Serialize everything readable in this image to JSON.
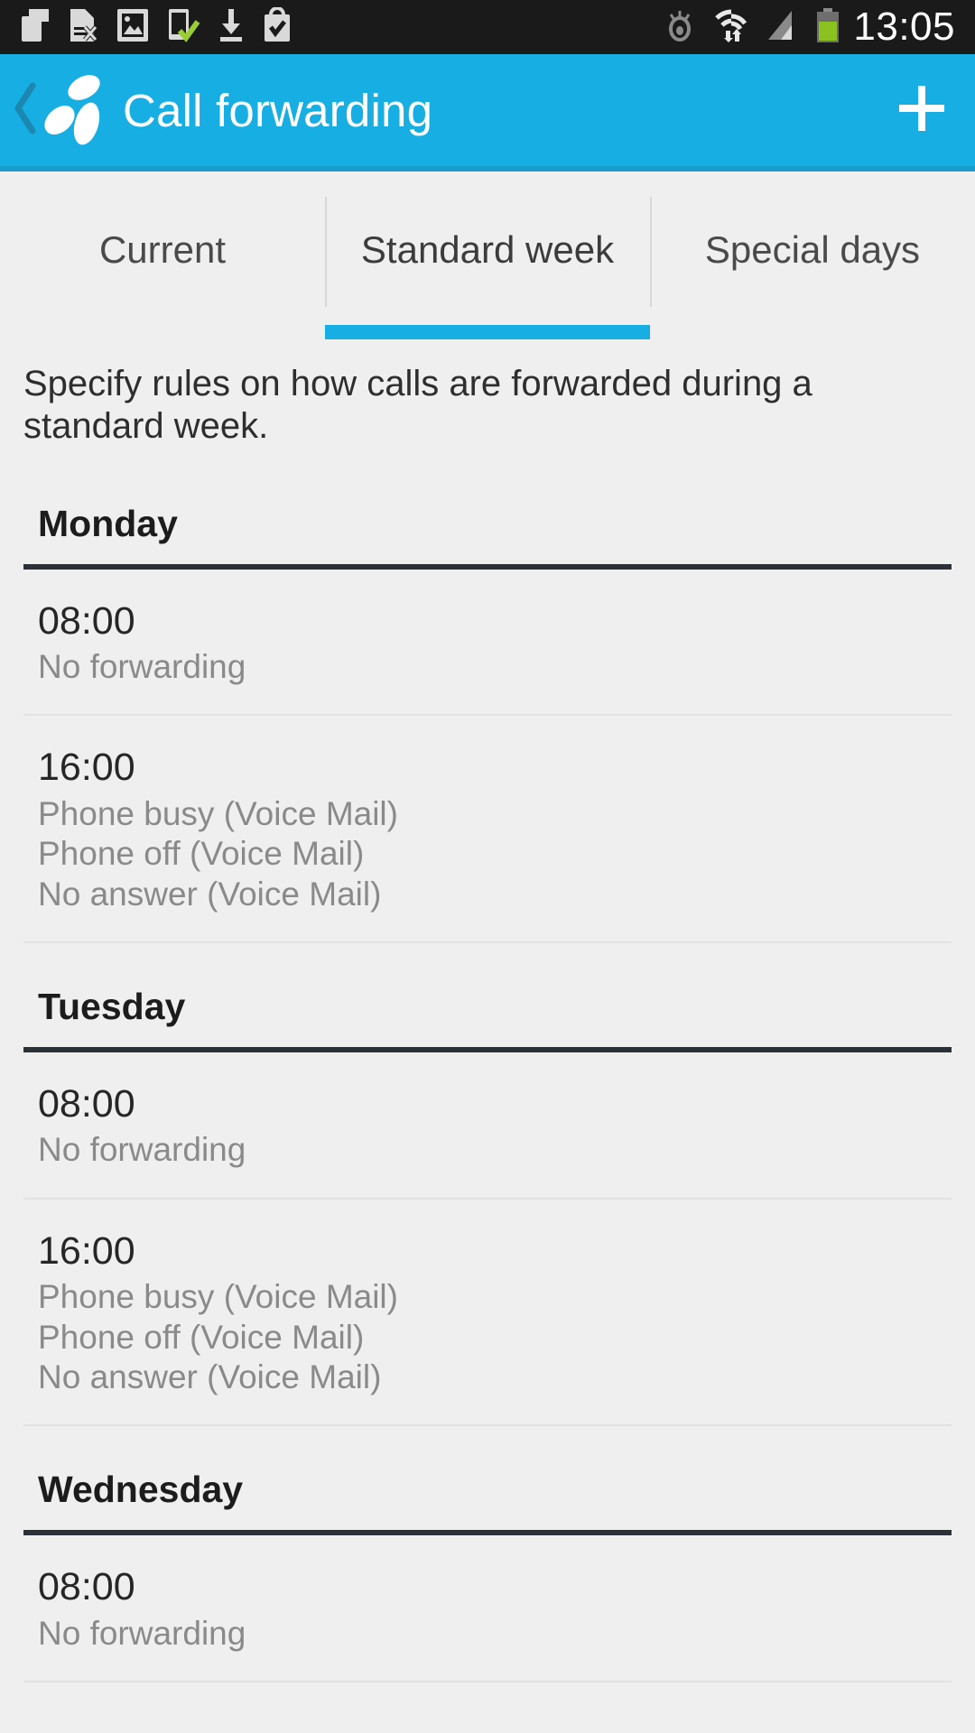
{
  "status_bar": {
    "time": "13:05",
    "left_icons": [
      "sim-card-icon",
      "sim-card-error-icon",
      "screenshot-image-icon",
      "device-check-icon",
      "download-icon",
      "play-store-bag-check-icon"
    ],
    "right_icons": [
      "eye-blocked-icon",
      "wifi-data-transfer-icon",
      "cellular-signal-icon",
      "battery-icon"
    ]
  },
  "app_bar": {
    "title": "Call forwarding",
    "back_label": "Back",
    "logo_name": "telenor-propeller-logo",
    "add_label": "Add",
    "background_color": "#17AEE3"
  },
  "tabs": {
    "active_index": 1,
    "indicator_color": "#17AEE3",
    "items": [
      {
        "label": "Current"
      },
      {
        "label": "Standard week"
      },
      {
        "label": "Special days"
      }
    ]
  },
  "description": "Specify rules on how calls are forwarded during a standard week.",
  "days": [
    {
      "name": "Monday",
      "entries": [
        {
          "time": "08:00",
          "rules": [
            "No forwarding"
          ]
        },
        {
          "time": "16:00",
          "rules": [
            "Phone busy (Voice Mail)",
            "Phone off (Voice Mail)",
            "No answer (Voice Mail)"
          ]
        }
      ]
    },
    {
      "name": "Tuesday",
      "entries": [
        {
          "time": "08:00",
          "rules": [
            "No forwarding"
          ]
        },
        {
          "time": "16:00",
          "rules": [
            "Phone busy (Voice Mail)",
            "Phone off (Voice Mail)",
            "No answer (Voice Mail)"
          ]
        }
      ]
    },
    {
      "name": "Wednesday",
      "entries": [
        {
          "time": "08:00",
          "rules": [
            "No forwarding"
          ]
        }
      ]
    }
  ]
}
